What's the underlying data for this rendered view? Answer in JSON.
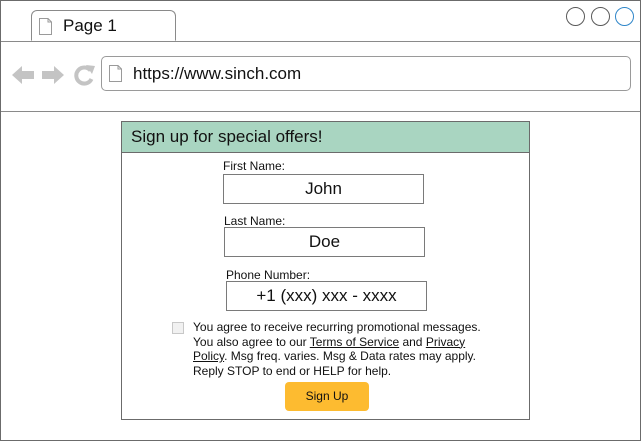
{
  "browser": {
    "tab_label": "Page 1",
    "url": "https://www.sinch.com"
  },
  "form": {
    "title": "Sign up for special offers!",
    "fields": [
      {
        "label": "First Name:",
        "value": "John"
      },
      {
        "label": "Last Name:",
        "value": "Doe"
      },
      {
        "label": "Phone Number:",
        "value": "+1 (xxx) xxx - xxxx"
      }
    ],
    "consent": {
      "checked": false,
      "part1": "You agree to receive recurring promotional messages. You also agree to our ",
      "terms_link": "Terms of Service",
      "part2": " and ",
      "privacy_link": "Privacy Policy",
      "part3": ". Msg freq. varies. Msg & Data rates may apply. Reply STOP to end or HELP for help."
    },
    "submit_label": "Sign Up"
  },
  "colors": {
    "header_bg": "#a9d5c1",
    "button_bg": "#fdbb30",
    "accent_window_btn": "#2f86c9"
  }
}
